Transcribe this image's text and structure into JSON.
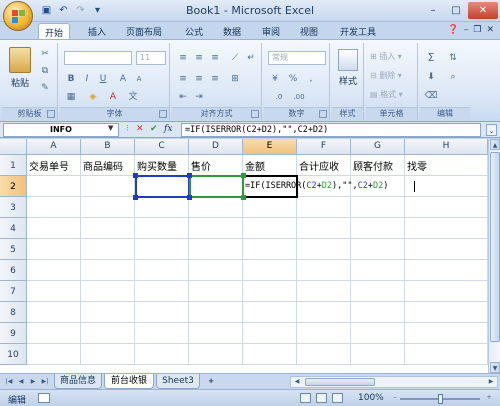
{
  "window": {
    "title": "Book1 - Microsoft Excel",
    "controls": [
      "–",
      "□",
      "✕"
    ]
  },
  "quick_access": [
    "save-icon",
    "undo-icon",
    "redo-icon",
    "customize-icon"
  ],
  "tabs": [
    {
      "label": "开始",
      "active": true
    },
    {
      "label": "插入"
    },
    {
      "label": "页面布局"
    },
    {
      "label": "公式"
    },
    {
      "label": "数据"
    },
    {
      "label": "审阅"
    },
    {
      "label": "视图"
    },
    {
      "label": "开发工具"
    }
  ],
  "ribbon": {
    "clipboard": {
      "label": "剪贴板",
      "paste": "粘贴"
    },
    "font": {
      "label": "字体",
      "font_size": "11"
    },
    "alignment": {
      "label": "对齐方式"
    },
    "number": {
      "label": "数字",
      "format": "常规"
    },
    "styles": {
      "label": "样式",
      "button": "样式"
    },
    "cells": {
      "label": "单元格",
      "insert": "插入",
      "delete": "删除",
      "format": "格式"
    },
    "editing": {
      "label": "编辑"
    }
  },
  "formula_bar": {
    "name_box": "INFO",
    "formula": "=IF(ISERROR(C2+D2),\"\",C2+D2)"
  },
  "grid": {
    "columns": [
      "A",
      "B",
      "C",
      "D",
      "E",
      "F",
      "G",
      "H"
    ],
    "selected_column": "E",
    "rows": [
      "1",
      "2",
      "3",
      "4",
      "5",
      "6",
      "7",
      "8",
      "9",
      "10"
    ],
    "selected_row": "2",
    "headers": [
      "交易单号",
      "商品编码",
      "购买数量",
      "售价",
      "金额",
      "合计应收",
      "顾客付款",
      "找零"
    ],
    "editing_cell": {
      "parts": [
        "=IF(ISERROR(",
        "C2",
        "+",
        "D2",
        "),\"\",",
        "C2",
        "+",
        "D2",
        ")"
      ]
    }
  },
  "sheets": [
    {
      "label": "商品信息"
    },
    {
      "label": "前台收银",
      "active": true
    },
    {
      "label": "Sheet3"
    }
  ],
  "status": {
    "mode": "编辑",
    "zoom": "100%"
  }
}
